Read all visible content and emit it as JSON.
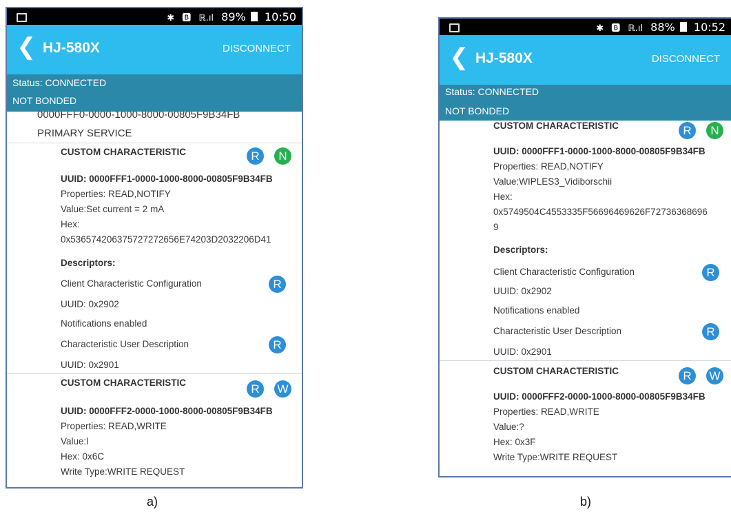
{
  "colors": {
    "appbar": "#2ebbee",
    "statusbox": "#2b88a8",
    "read_badge": "#2d8fd8",
    "notify_badge": "#28b050"
  },
  "panel_a": {
    "statusbar": {
      "bt": "✱",
      "sim": "🅱",
      "signal": "ℝ.ıl",
      "battery": "89%",
      "time": "10:50"
    },
    "app_title": "HJ-580X",
    "disconnect": "DISCONNECT",
    "status": "Status: CONNECTED",
    "bond": "NOT BONDED",
    "service_uuid": "0000FFF0-0000-1000-8000-00805F9B34FB",
    "service_type": "PRIMARY SERVICE",
    "c1": {
      "name": "CUSTOM CHARACTERISTIC",
      "badge1": "R",
      "badge2": "N",
      "uuid": "UUID: 0000FFF1-0000-1000-8000-00805F9B34FB",
      "props": "Properties: READ,NOTIFY",
      "value": "Value:Set current = 2 mA",
      "hex_label": "Hex:",
      "hex": "0x536574206375727272656E74203D2032206D41",
      "descriptors": "Descriptors:",
      "d1": "Client Characteristic Configuration",
      "d1_badge": "R",
      "d1_uuid": "UUID: 0x2902",
      "d1_note": "Notifications enabled",
      "d2": "Characteristic User Description",
      "d2_badge": "R",
      "d2_uuid": "UUID: 0x2901"
    },
    "c2": {
      "name": "CUSTOM CHARACTERISTIC",
      "badge1": "R",
      "badge2": "W",
      "uuid": "UUID: 0000FFF2-0000-1000-8000-00805F9B34FB",
      "props": "Properties: READ,WRITE",
      "value": "Value:l",
      "hex": "Hex: 0x6C",
      "write_type": "Write Type:WRITE REQUEST"
    },
    "caption": "a)"
  },
  "panel_b": {
    "statusbar": {
      "bt": "✱",
      "sim": "🅱",
      "signal": "ℝ.ıl",
      "battery": "88%",
      "time": "10:52"
    },
    "app_title": "HJ-580X",
    "disconnect": "DISCONNECT",
    "status": "Status: CONNECTED",
    "bond": "NOT BONDED",
    "c1": {
      "name": "CUSTOM CHARACTERISTIC",
      "badge1": "R",
      "badge2": "N",
      "uuid": "UUID: 0000FFF1-0000-1000-8000-00805F9B34FB",
      "props": "Properties: READ,NOTIFY",
      "value": "Value:WIPLES3_Vidiborschii",
      "hex_label": "Hex:",
      "hex1": "0x5749504C4553335F56696469626F72736368696",
      "hex2": "9",
      "descriptors": "Descriptors:",
      "d1": "Client Characteristic Configuration",
      "d1_badge": "R",
      "d1_uuid": "UUID: 0x2902",
      "d1_note": "Notifications enabled",
      "d2": "Characteristic User Description",
      "d2_badge": "R",
      "d2_uuid": "UUID: 0x2901"
    },
    "c2": {
      "name": "CUSTOM CHARACTERISTIC",
      "badge1": "R",
      "badge2": "W",
      "uuid": "UUID: 0000FFF2-0000-1000-8000-00805F9B34FB",
      "props": "Properties: READ,WRITE",
      "value": "Value:?",
      "hex": "Hex: 0x3F",
      "write_type": "Write Type:WRITE REQUEST"
    },
    "caption": "b)"
  }
}
